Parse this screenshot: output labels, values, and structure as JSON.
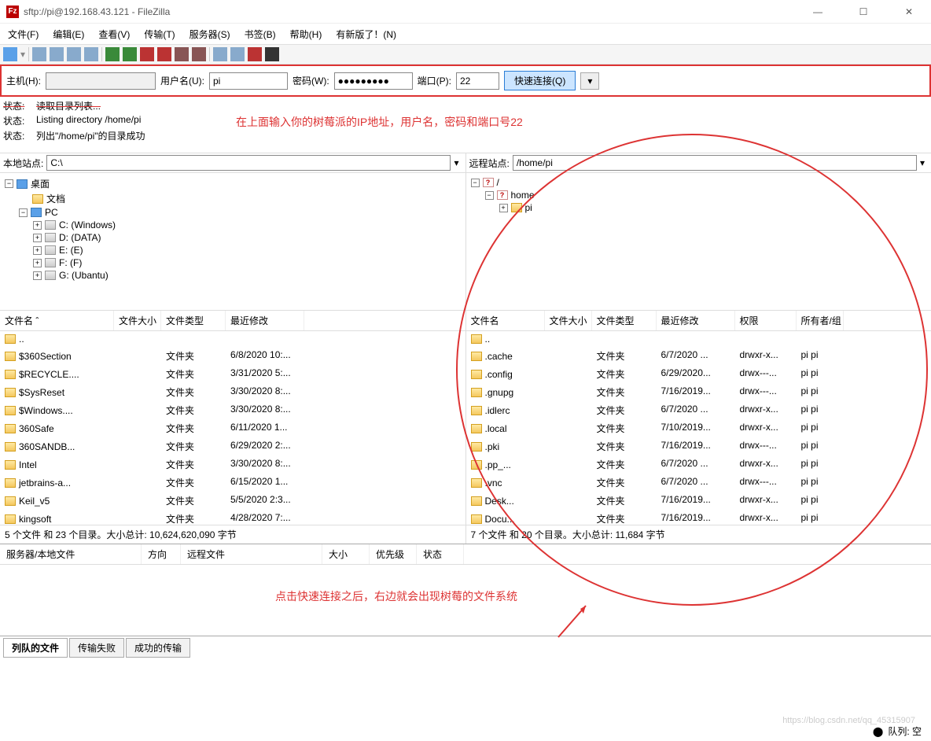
{
  "title": "sftp://pi@192.168.43.121 - FileZilla",
  "menu": [
    "文件(F)",
    "编辑(E)",
    "查看(V)",
    "传输(T)",
    "服务器(S)",
    "书签(B)",
    "帮助(H)",
    "有新版了！(N)"
  ],
  "qc": {
    "host_lbl": "主机(H):",
    "user_lbl": "用户名(U):",
    "user_val": "pi",
    "pass_lbl": "密码(W):",
    "pass_val": "●●●●●●●●●",
    "port_lbl": "端口(P):",
    "port_val": "22",
    "btn": "快速连接(Q)",
    "dd": "▾"
  },
  "log": [
    {
      "lbl": "状态:",
      "msg": "读取目录列表..."
    },
    {
      "lbl": "状态:",
      "msg": "Listing directory /home/pi"
    },
    {
      "lbl": "状态:",
      "msg": "列出\"/home/pi\"的目录成功"
    }
  ],
  "annot1": "在上面输入你的树莓派的IP地址，用户名，密码和端口号22",
  "annot2": "点击快速连接之后，右边就会出现树莓的文件系统",
  "local": {
    "lbl": "本地站点:",
    "path": "C:\\",
    "tree": [
      {
        "exp": "−",
        "icon": "pc",
        "txt": "桌面",
        "ind": 0
      },
      {
        "exp": "",
        "icon": "folder",
        "txt": "文档",
        "ind": 1
      },
      {
        "exp": "−",
        "icon": "pc",
        "txt": "PC",
        "ind": 1
      },
      {
        "exp": "+",
        "icon": "drive",
        "txt": "C: (Windows)",
        "ind": 2
      },
      {
        "exp": "+",
        "icon": "drive",
        "txt": "D: (DATA)",
        "ind": 2
      },
      {
        "exp": "+",
        "icon": "drive",
        "txt": "E: (E)",
        "ind": 2
      },
      {
        "exp": "+",
        "icon": "drive",
        "txt": "F: (F)",
        "ind": 2
      },
      {
        "exp": "+",
        "icon": "drive",
        "txt": "G: (Ubantu)",
        "ind": 2
      }
    ]
  },
  "remote": {
    "lbl": "远程站点:",
    "path": "/home/pi",
    "tree": [
      {
        "exp": "−",
        "icon": "q",
        "txt": "/",
        "ind": 0
      },
      {
        "exp": "−",
        "icon": "q",
        "txt": "home",
        "ind": 1
      },
      {
        "exp": "+",
        "icon": "folder",
        "txt": "pi",
        "ind": 2
      }
    ]
  },
  "lcols": [
    "文件名 ˆ",
    "文件大小",
    "文件类型",
    "最近修改"
  ],
  "rcols": [
    "文件名",
    "文件大小",
    "文件类型",
    "最近修改",
    "权限",
    "所有者/组"
  ],
  "lfiles": [
    {
      "n": "..",
      "s": "",
      "t": "",
      "m": ""
    },
    {
      "n": "$360Section",
      "s": "",
      "t": "文件夹",
      "m": "6/8/2020 10:..."
    },
    {
      "n": "$RECYCLE....",
      "s": "",
      "t": "文件夹",
      "m": "3/31/2020 5:..."
    },
    {
      "n": "$SysReset",
      "s": "",
      "t": "文件夹",
      "m": "3/30/2020 8:..."
    },
    {
      "n": "$Windows....",
      "s": "",
      "t": "文件夹",
      "m": "3/30/2020 8:..."
    },
    {
      "n": "360Safe",
      "s": "",
      "t": "文件夹",
      "m": "6/11/2020 1..."
    },
    {
      "n": "360SANDB...",
      "s": "",
      "t": "文件夹",
      "m": "6/29/2020 2:..."
    },
    {
      "n": "Intel",
      "s": "",
      "t": "文件夹",
      "m": "3/30/2020 8:..."
    },
    {
      "n": "jetbrains-a...",
      "s": "",
      "t": "文件夹",
      "m": "6/15/2020 1..."
    },
    {
      "n": "Keil_v5",
      "s": "",
      "t": "文件夹",
      "m": "5/5/2020 2:3..."
    },
    {
      "n": "kingsoft",
      "s": "",
      "t": "文件夹",
      "m": "4/28/2020 7:..."
    }
  ],
  "rfiles": [
    {
      "n": "..",
      "s": "",
      "t": "",
      "m": "",
      "p": "",
      "o": ""
    },
    {
      "n": ".cache",
      "s": "",
      "t": "文件夹",
      "m": "6/7/2020 ...",
      "p": "drwxr-x...",
      "o": "pi pi"
    },
    {
      "n": ".config",
      "s": "",
      "t": "文件夹",
      "m": "6/29/2020...",
      "p": "drwx---...",
      "o": "pi pi"
    },
    {
      "n": ".gnupg",
      "s": "",
      "t": "文件夹",
      "m": "7/16/2019...",
      "p": "drwx---...",
      "o": "pi pi"
    },
    {
      "n": ".idlerc",
      "s": "",
      "t": "文件夹",
      "m": "6/7/2020 ...",
      "p": "drwxr-x...",
      "o": "pi pi"
    },
    {
      "n": ".local",
      "s": "",
      "t": "文件夹",
      "m": "7/10/2019...",
      "p": "drwxr-x...",
      "o": "pi pi"
    },
    {
      "n": ".pki",
      "s": "",
      "t": "文件夹",
      "m": "7/16/2019...",
      "p": "drwx---...",
      "o": "pi pi"
    },
    {
      "n": ".pp_...",
      "s": "",
      "t": "文件夹",
      "m": "6/7/2020 ...",
      "p": "drwxr-x...",
      "o": "pi pi"
    },
    {
      "n": ".vnc",
      "s": "",
      "t": "文件夹",
      "m": "6/7/2020 ...",
      "p": "drwx---...",
      "o": "pi pi"
    },
    {
      "n": "Desk...",
      "s": "",
      "t": "文件夹",
      "m": "7/16/2019...",
      "p": "drwxr-x...",
      "o": "pi pi"
    },
    {
      "n": "Docu...",
      "s": "",
      "t": "文件夹",
      "m": "7/16/2019...",
      "p": "drwxr-x...",
      "o": "pi pi"
    }
  ],
  "lstatus": "5 个文件 和 23 个目录。大小总计: 10,624,620,090 字节",
  "rstatus": "7 个文件 和 20 个目录。大小总计: 11,684 字节",
  "qcols": [
    "服务器/本地文件",
    "方向",
    "远程文件",
    "大小",
    "优先级",
    "状态"
  ],
  "tabs": [
    "列队的文件",
    "传输失败",
    "成功的传输"
  ],
  "footer": "队列: 空",
  "watermark": "https://blog.csdn.net/qq_45315907"
}
